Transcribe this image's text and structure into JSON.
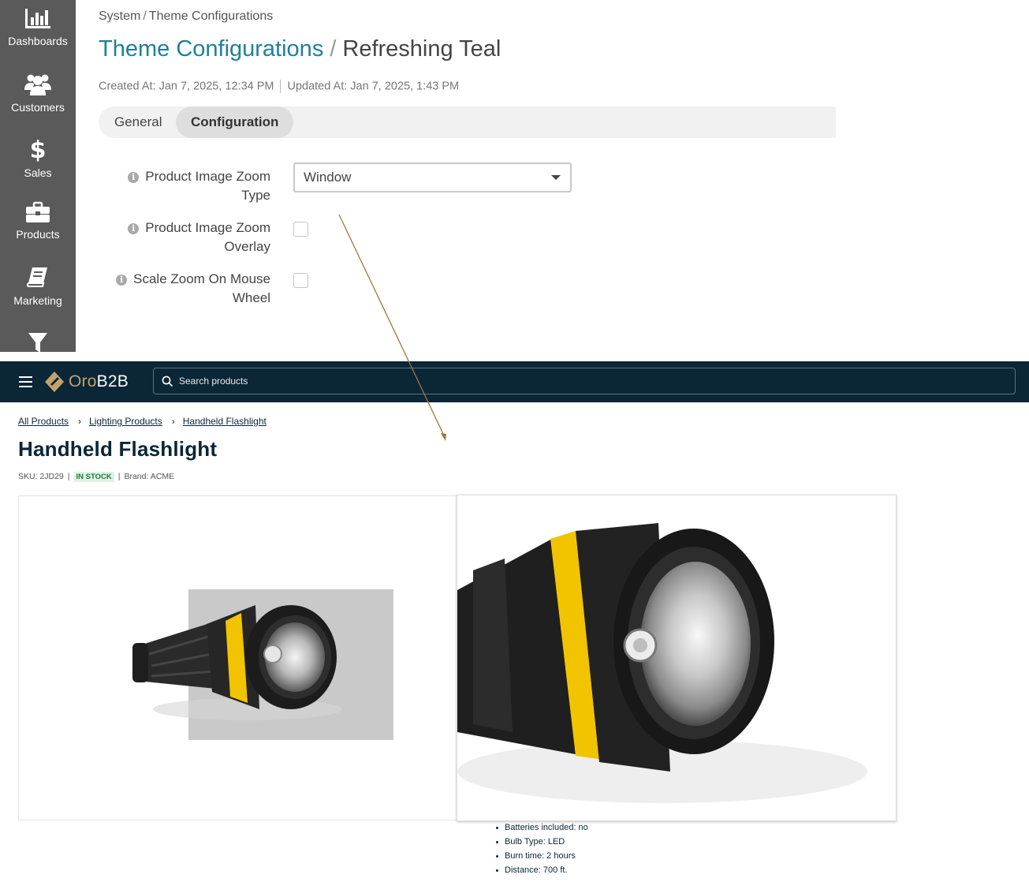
{
  "sidebar": {
    "items": [
      {
        "label": "Dashboards",
        "icon": "bar-chart-icon"
      },
      {
        "label": "Customers",
        "icon": "users-icon"
      },
      {
        "label": "Sales",
        "icon": "dollar-icon"
      },
      {
        "label": "Products",
        "icon": "briefcase-icon"
      },
      {
        "label": "Marketing",
        "icon": "book-icon"
      },
      {
        "label": "",
        "icon": "filter-icon"
      }
    ]
  },
  "admin": {
    "breadcrumb": [
      "System",
      "Theme Configurations"
    ],
    "title_section": "Theme Configurations",
    "title_separator": "/",
    "title_entity": "Refreshing Teal",
    "created": "Created At: Jan 7, 2025, 12:34 PM",
    "updated": "Updated At: Jan 7, 2025, 1:43 PM",
    "tabs": [
      {
        "label": "General",
        "active": false
      },
      {
        "label": "Configuration",
        "active": true
      }
    ],
    "fields": [
      {
        "label_line1": "Product Image Zoom",
        "label_line2": "Type",
        "type": "select",
        "value": "Window"
      },
      {
        "label_line1": "Product Image Zoom",
        "label_line2": "Overlay",
        "type": "checkbox",
        "checked": false
      },
      {
        "label_line1": "Scale Zoom On Mouse",
        "label_line2": "Wheel",
        "type": "checkbox",
        "checked": false
      }
    ],
    "info_glyph": "i"
  },
  "storefront": {
    "logo_oro": "Oro",
    "logo_b2b": "B2B",
    "search_placeholder": "Search products",
    "breadcrumb": [
      "All Products",
      "Lighting Products",
      "Handheld Flashlight"
    ],
    "breadcrumb_separator": "›",
    "product_title": "Handheld Flashlight",
    "sku": "SKU: 2JD29",
    "stock": "IN STOCK",
    "brand": "Brand: ACME",
    "meta_separator": "|",
    "specs": [
      "Batteries included: no",
      "Bulb Type: LED",
      "Burn time: 2 hours",
      "Distance: 700 ft."
    ]
  },
  "colors": {
    "admin_sidebar": "#5a5a5a",
    "admin_accent": "#1f7f9a",
    "store_navbar": "#0a2637",
    "logo_gold": "#c3a269",
    "in_stock_bg": "#dff3e3",
    "in_stock_text": "#1d7a3a",
    "flashlight_band": "#f2c400",
    "annotation_arrow": "#9a7a3a"
  }
}
